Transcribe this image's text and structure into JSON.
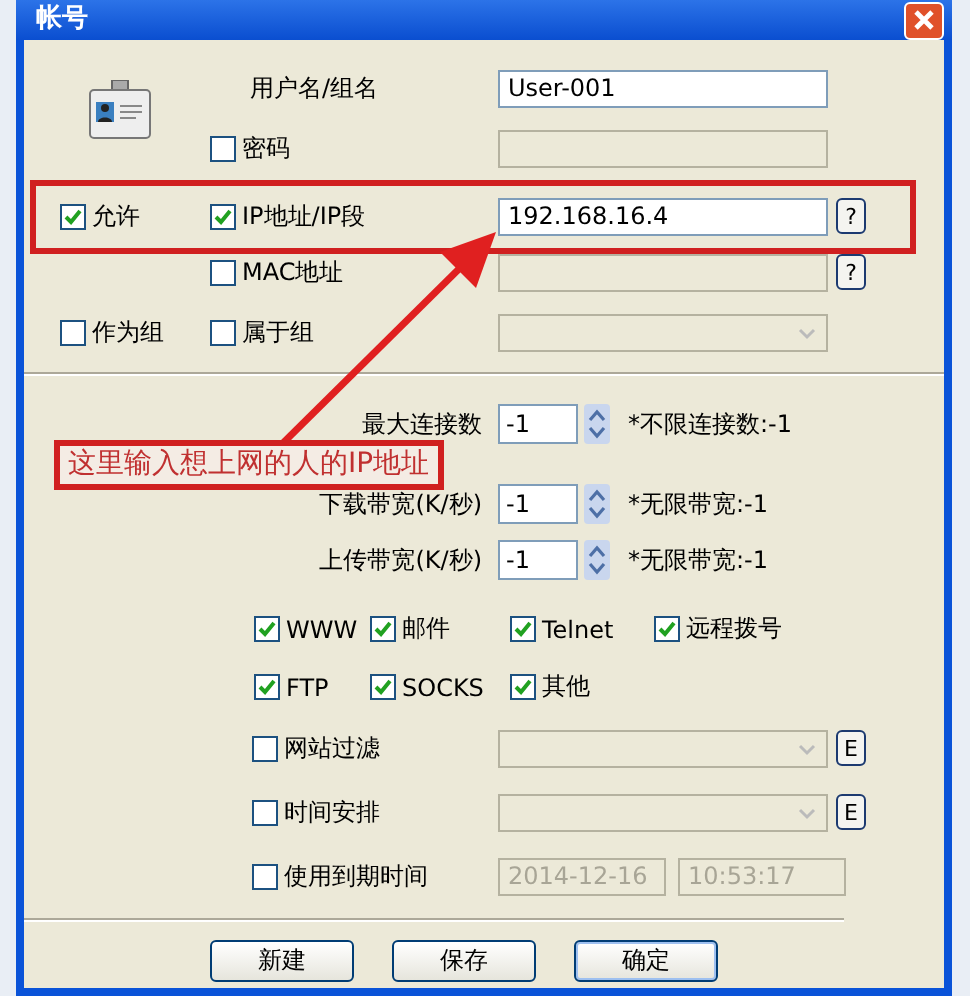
{
  "window": {
    "title": "帐号"
  },
  "account": {
    "label": "用户名/组名",
    "value": "User-001"
  },
  "password": {
    "label": "密码",
    "checked": false
  },
  "allow": {
    "label": "允许",
    "checked": true
  },
  "ip": {
    "label": "IP地址/IP段",
    "checked": true,
    "value": "192.168.16.4",
    "help": "?"
  },
  "mac": {
    "label": "MAC地址",
    "checked": false,
    "help": "?"
  },
  "as_group": {
    "label": "作为组",
    "checked": false
  },
  "member_of": {
    "label": "属于组",
    "checked": false
  },
  "limits": [
    {
      "label": "最大连接数",
      "value": "-1",
      "note": "*不限连接数:-1"
    },
    {
      "label": "下载带宽(K/秒)",
      "value": "-1",
      "note": "*无限带宽:-1"
    },
    {
      "label": "上传带宽(K/秒)",
      "value": "-1",
      "note": "*无限带宽:-1"
    }
  ],
  "protocols": [
    {
      "label": "WWW",
      "checked": true
    },
    {
      "label": "邮件",
      "checked": true
    },
    {
      "label": "Telnet",
      "checked": true
    },
    {
      "label": "远程拨号",
      "checked": true
    },
    {
      "label": "FTP",
      "checked": true
    },
    {
      "label": "SOCKS",
      "checked": true
    },
    {
      "label": "其他",
      "checked": true
    }
  ],
  "filters": [
    {
      "label": "网站过滤",
      "checked": false,
      "button": "E"
    },
    {
      "label": "时间安排",
      "checked": false,
      "button": "E"
    }
  ],
  "expiry": {
    "label": "使用到期时间",
    "checked": false,
    "date": "2014-12-16",
    "time": "10:53:17"
  },
  "buttons": [
    "新建",
    "保存",
    "确定"
  ],
  "annotation": {
    "text": "这里输入想上网的人的IP地址"
  }
}
